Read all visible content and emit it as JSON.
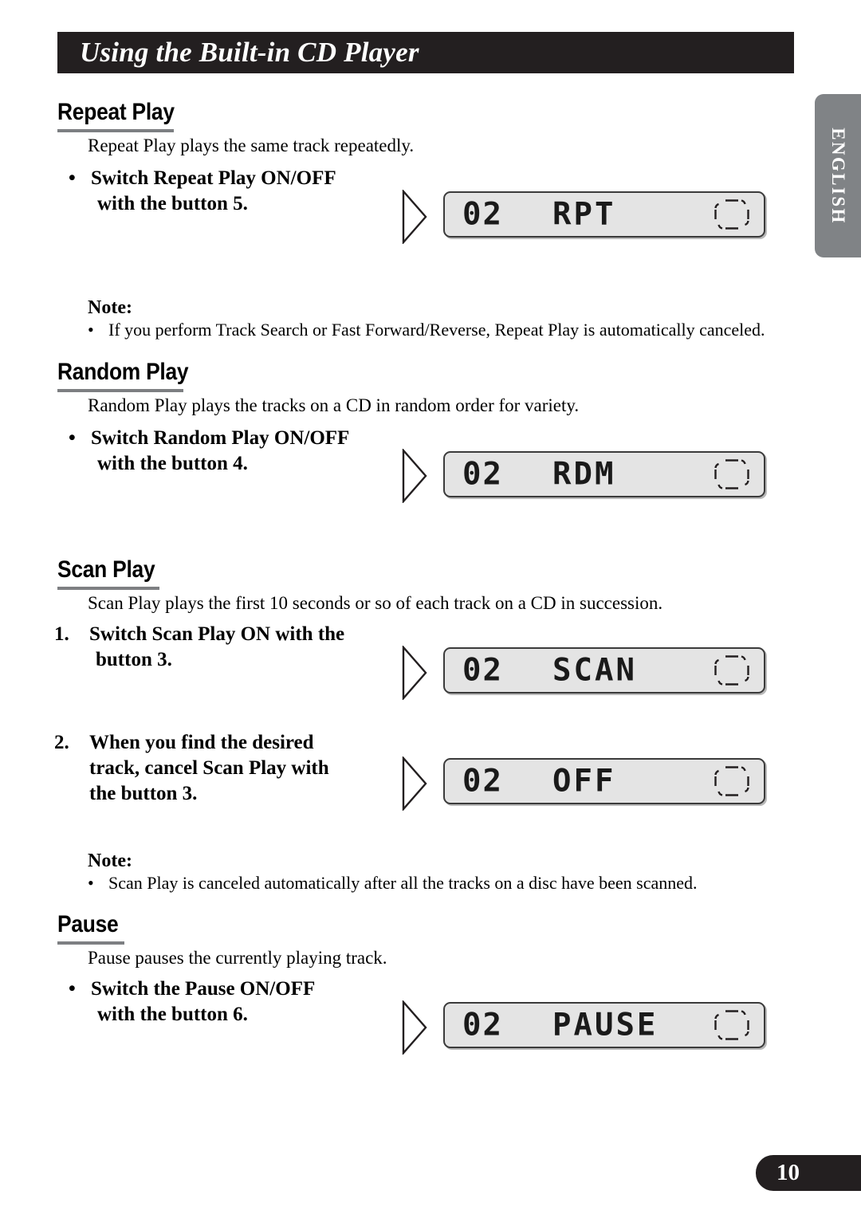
{
  "header": {
    "title": "Using the Built-in CD Player"
  },
  "side_tab": {
    "label": "ENGLISH"
  },
  "footer": {
    "page_number": "10"
  },
  "sections": [
    {
      "heading": "Repeat Play",
      "description": "Repeat Play plays the same track repeatedly.",
      "instructions": [
        {
          "marker": "•",
          "lines": [
            "Switch Repeat Play ON/OFF",
            "with the button 5."
          ],
          "display": {
            "track": "02",
            "text": "RPT"
          }
        }
      ],
      "note": {
        "title": "Note:",
        "items": [
          "If you perform Track Search or Fast Forward/Reverse, Repeat Play is automatically canceled."
        ]
      }
    },
    {
      "heading": "Random Play",
      "description": "Random Play plays the tracks on a CD in random order for variety.",
      "instructions": [
        {
          "marker": "•",
          "lines": [
            "Switch Random Play ON/OFF",
            "with the button 4."
          ],
          "display": {
            "track": "02",
            "text": "RDM"
          }
        }
      ]
    },
    {
      "heading": "Scan Play",
      "description": "Scan Play plays the first 10 seconds or so of each track on a CD in succession.",
      "instructions": [
        {
          "marker": "1.",
          "lines": [
            "Switch Scan Play ON with the",
            "button 3."
          ],
          "display": {
            "track": "02",
            "text": "SCAN"
          }
        },
        {
          "marker": "2.",
          "lines": [
            "When you find the desired",
            "track, cancel Scan Play with",
            "the button 3."
          ],
          "display": {
            "track": "02",
            "text": "OFF"
          }
        }
      ],
      "note": {
        "title": "Note:",
        "items": [
          "Scan Play is canceled automatically after all the tracks on a disc have been scanned."
        ]
      }
    },
    {
      "heading": "Pause",
      "description": "Pause pauses the currently playing track.",
      "instructions": [
        {
          "marker": "•",
          "lines": [
            "Switch the Pause ON/OFF",
            "with the button 6."
          ],
          "display": {
            "track": "02",
            "text": "PAUSE"
          }
        }
      ]
    }
  ],
  "colors": {
    "header_bg": "#231f20",
    "tab_bg": "#808386",
    "rule": "#7d7f82",
    "lcd_bg": "#e4e4e4",
    "lcd_border": "#3b3b3b"
  }
}
